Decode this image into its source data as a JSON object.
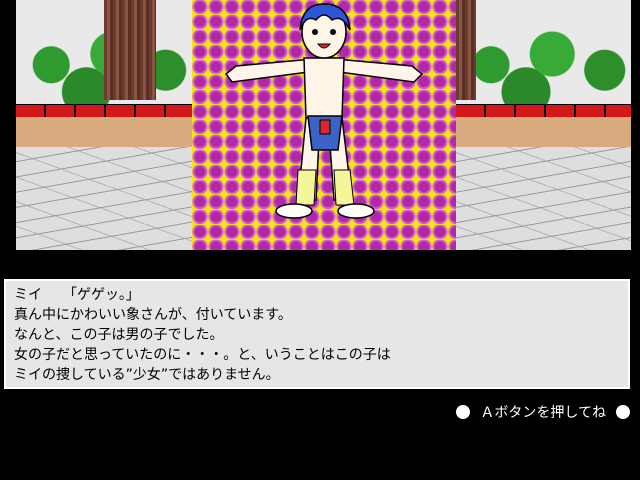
{
  "dialogue": {
    "speaker": "ミイ",
    "lines": [
      "ミイ　　「ゲゲッ。」",
      "真ん中にかわいい象さんが、付いています。",
      "なんと、この子は男の子でした。",
      "女の子だと思っていたのに・・・。と、いうことはこの子は",
      "ミイの捜している”少女”ではありません。"
    ]
  },
  "prompt": {
    "label": "Ａボタンを押してね",
    "left_icon": "circle-icon",
    "right_icon": "circle-icon"
  },
  "colors": {
    "background": "#000000",
    "textbox": "#e6e6e6",
    "pattern_yellow": "#f3e412",
    "pattern_purple": "#b02aa8",
    "brick": "#d21818",
    "hair": "#2a55d8"
  }
}
